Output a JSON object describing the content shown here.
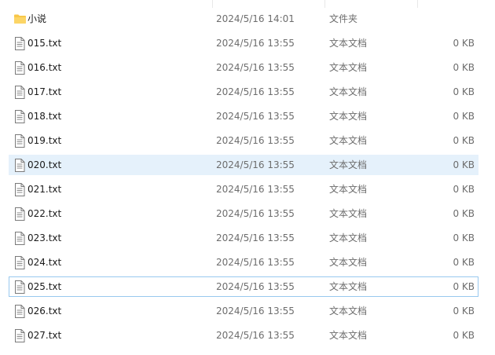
{
  "files": [
    {
      "name": "小说",
      "date": "2024/5/16 14:01",
      "type": "文件夹",
      "size": "",
      "icon": "folder-icon"
    },
    {
      "name": "015.txt",
      "date": "2024/5/16 13:55",
      "type": "文本文档",
      "size": "0 KB",
      "icon": "text-file-icon"
    },
    {
      "name": "016.txt",
      "date": "2024/5/16 13:55",
      "type": "文本文档",
      "size": "0 KB",
      "icon": "text-file-icon"
    },
    {
      "name": "017.txt",
      "date": "2024/5/16 13:55",
      "type": "文本文档",
      "size": "0 KB",
      "icon": "text-file-icon"
    },
    {
      "name": "018.txt",
      "date": "2024/5/16 13:55",
      "type": "文本文档",
      "size": "0 KB",
      "icon": "text-file-icon"
    },
    {
      "name": "019.txt",
      "date": "2024/5/16 13:55",
      "type": "文本文档",
      "size": "0 KB",
      "icon": "text-file-icon"
    },
    {
      "name": "020.txt",
      "date": "2024/5/16 13:55",
      "type": "文本文档",
      "size": "0 KB",
      "icon": "text-file-icon"
    },
    {
      "name": "021.txt",
      "date": "2024/5/16 13:55",
      "type": "文本文档",
      "size": "0 KB",
      "icon": "text-file-icon"
    },
    {
      "name": "022.txt",
      "date": "2024/5/16 13:55",
      "type": "文本文档",
      "size": "0 KB",
      "icon": "text-file-icon"
    },
    {
      "name": "023.txt",
      "date": "2024/5/16 13:55",
      "type": "文本文档",
      "size": "0 KB",
      "icon": "text-file-icon"
    },
    {
      "name": "024.txt",
      "date": "2024/5/16 13:55",
      "type": "文本文档",
      "size": "0 KB",
      "icon": "text-file-icon"
    },
    {
      "name": "025.txt",
      "date": "2024/5/16 13:55",
      "type": "文本文档",
      "size": "0 KB",
      "icon": "text-file-icon"
    },
    {
      "name": "026.txt",
      "date": "2024/5/16 13:55",
      "type": "文本文档",
      "size": "0 KB",
      "icon": "text-file-icon"
    },
    {
      "name": "027.txt",
      "date": "2024/5/16 13:55",
      "type": "文本文档",
      "size": "0 KB",
      "icon": "text-file-icon"
    }
  ],
  "selected_name": "020.txt",
  "focused_name": "025.txt",
  "colors": {
    "selection": "#e5f1fb",
    "focus_border": "#99c9ef",
    "folder": "#f8c749",
    "secondary_text": "#6d6d6d"
  }
}
